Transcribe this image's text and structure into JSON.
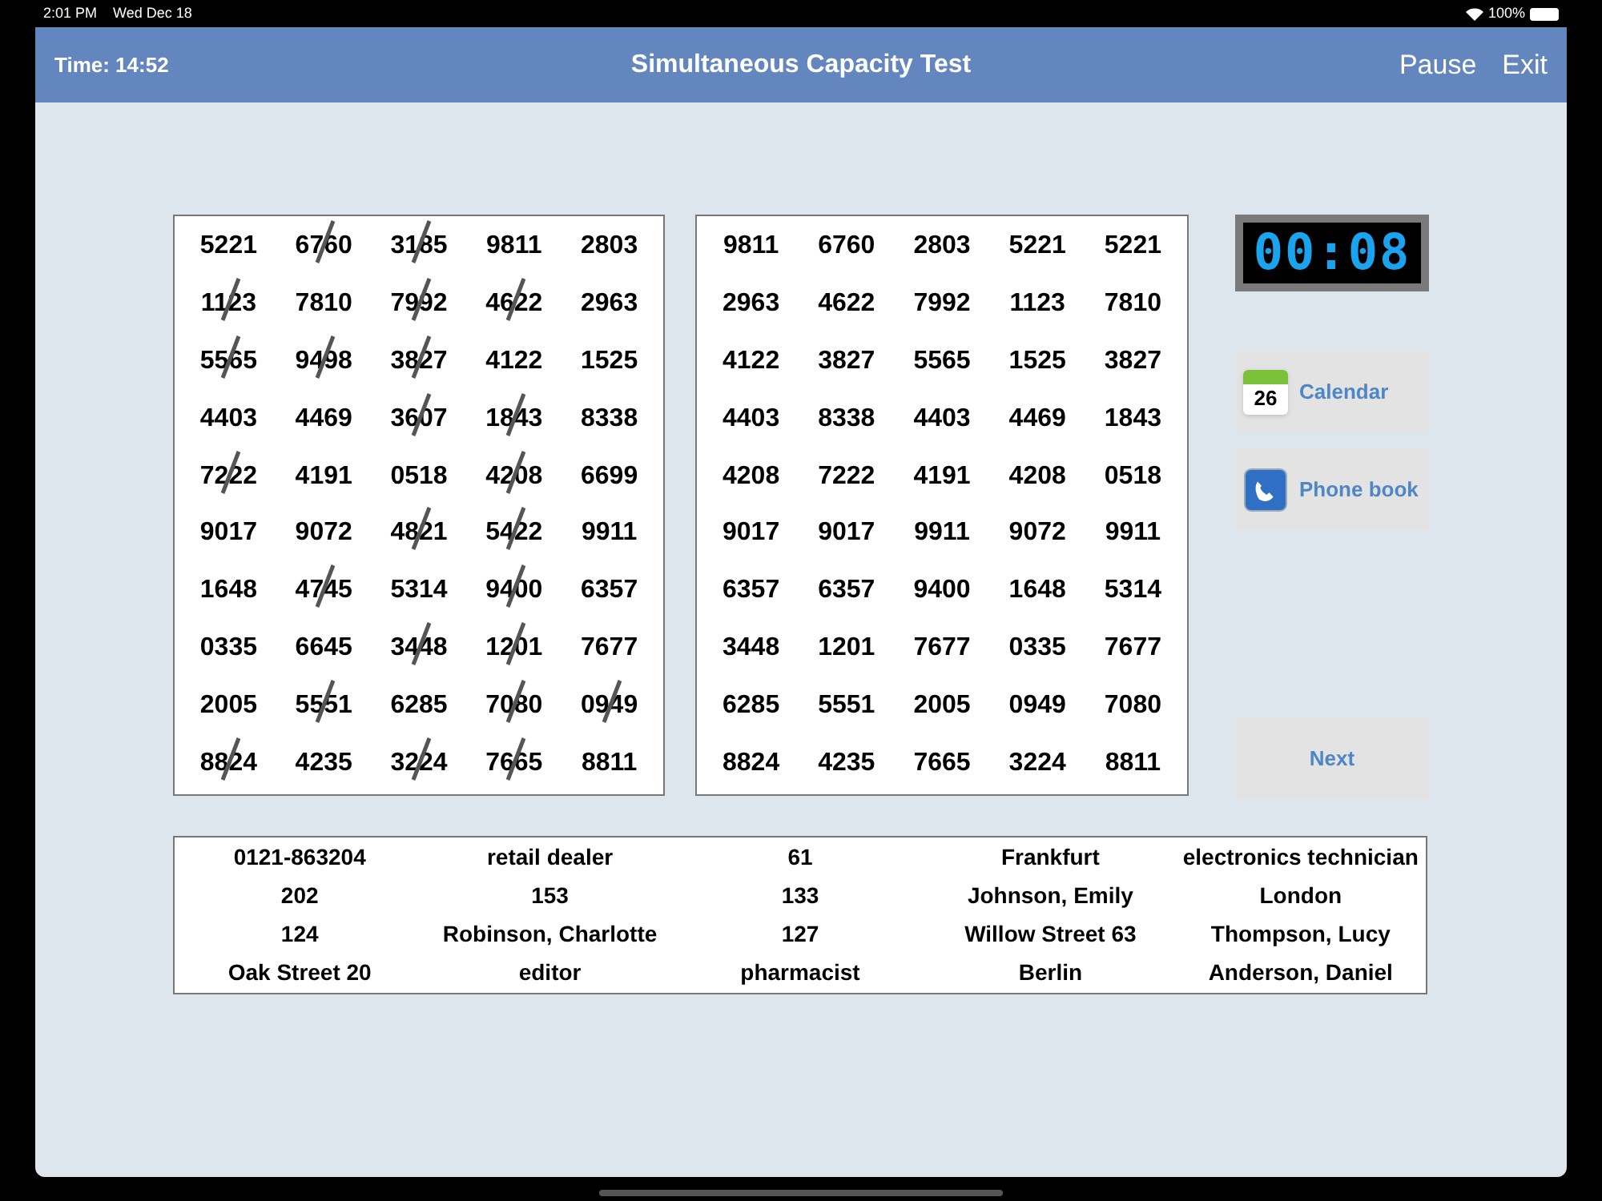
{
  "status_bar": {
    "time": "2:01 PM",
    "date": "Wed Dec 18",
    "battery": "100%"
  },
  "header": {
    "timer": "Time: 14:52",
    "title": "Simultaneous Capacity Test",
    "actions": [
      "Pause",
      "Exit"
    ]
  },
  "left_grid": [
    [
      {
        "text": "5221",
        "struck": false
      },
      {
        "text": "6760",
        "struck": true
      },
      {
        "text": "3185",
        "struck": true
      },
      {
        "text": "9811",
        "struck": false
      },
      {
        "text": "2803",
        "struck": false
      }
    ],
    [
      {
        "text": "1123",
        "struck": true
      },
      {
        "text": "7810",
        "struck": false
      },
      {
        "text": "7992",
        "struck": true
      },
      {
        "text": "4622",
        "struck": true
      },
      {
        "text": "2963",
        "struck": false
      }
    ],
    [
      {
        "text": "5565",
        "struck": true
      },
      {
        "text": "9498",
        "struck": true
      },
      {
        "text": "3827",
        "struck": true
      },
      {
        "text": "4122",
        "struck": false
      },
      {
        "text": "1525",
        "struck": false
      }
    ],
    [
      {
        "text": "4403",
        "struck": false
      },
      {
        "text": "4469",
        "struck": false
      },
      {
        "text": "3607",
        "struck": true
      },
      {
        "text": "1843",
        "struck": true
      },
      {
        "text": "8338",
        "struck": false
      }
    ],
    [
      {
        "text": "7222",
        "struck": true
      },
      {
        "text": "4191",
        "struck": false
      },
      {
        "text": "0518",
        "struck": false
      },
      {
        "text": "4208",
        "struck": true
      },
      {
        "text": "6699",
        "struck": false
      }
    ],
    [
      {
        "text": "9017",
        "struck": false
      },
      {
        "text": "9072",
        "struck": false
      },
      {
        "text": "4821",
        "struck": true
      },
      {
        "text": "5422",
        "struck": true
      },
      {
        "text": "9911",
        "struck": false
      }
    ],
    [
      {
        "text": "1648",
        "struck": false
      },
      {
        "text": "4745",
        "struck": true
      },
      {
        "text": "5314",
        "struck": false
      },
      {
        "text": "9400",
        "struck": true
      },
      {
        "text": "6357",
        "struck": false
      }
    ],
    [
      {
        "text": "0335",
        "struck": false
      },
      {
        "text": "6645",
        "struck": false
      },
      {
        "text": "3448",
        "struck": true
      },
      {
        "text": "1201",
        "struck": true
      },
      {
        "text": "7677",
        "struck": false
      }
    ],
    [
      {
        "text": "2005",
        "struck": false
      },
      {
        "text": "5551",
        "struck": true
      },
      {
        "text": "6285",
        "struck": false
      },
      {
        "text": "7080",
        "struck": true
      },
      {
        "text": "0949",
        "struck": true
      }
    ],
    [
      {
        "text": "8824",
        "struck": true
      },
      {
        "text": "4235",
        "struck": false
      },
      {
        "text": "3224",
        "struck": true
      },
      {
        "text": "7665",
        "struck": true
      },
      {
        "text": "8811",
        "struck": false
      }
    ]
  ],
  "right_grid": [
    [
      "9811",
      "6760",
      "2803",
      "5221",
      "5221"
    ],
    [
      "2963",
      "4622",
      "7992",
      "1123",
      "7810"
    ],
    [
      "4122",
      "3827",
      "5565",
      "1525",
      "3827"
    ],
    [
      "4403",
      "8338",
      "4403",
      "4469",
      "1843"
    ],
    [
      "4208",
      "7222",
      "4191",
      "4208",
      "0518"
    ],
    [
      "9017",
      "9017",
      "9911",
      "9072",
      "9911"
    ],
    [
      "6357",
      "6357",
      "9400",
      "1648",
      "5314"
    ],
    [
      "3448",
      "1201",
      "7677",
      "0335",
      "7677"
    ],
    [
      "6285",
      "5551",
      "2005",
      "0949",
      "7080"
    ],
    [
      "8824",
      "4235",
      "7665",
      "3224",
      "8811"
    ]
  ],
  "clock": "00:08",
  "side_buttons": [
    {
      "kind": "calendar",
      "label": "Calendar",
      "icon_text": "26"
    },
    {
      "kind": "phone",
      "label": "Phone book"
    }
  ],
  "next_button": "Next",
  "info_table": [
    [
      "0121-863204",
      "retail dealer",
      "61",
      "Frankfurt",
      "electronics technician"
    ],
    [
      "202",
      "153",
      "133",
      "Johnson, Emily",
      "London"
    ],
    [
      "124",
      "Robinson, Charlotte",
      "127",
      "Willow Street 63",
      "Thompson, Lucy"
    ],
    [
      "Oak Street 20",
      "editor",
      "pharmacist",
      "Berlin",
      "Anderson, Daniel"
    ]
  ]
}
